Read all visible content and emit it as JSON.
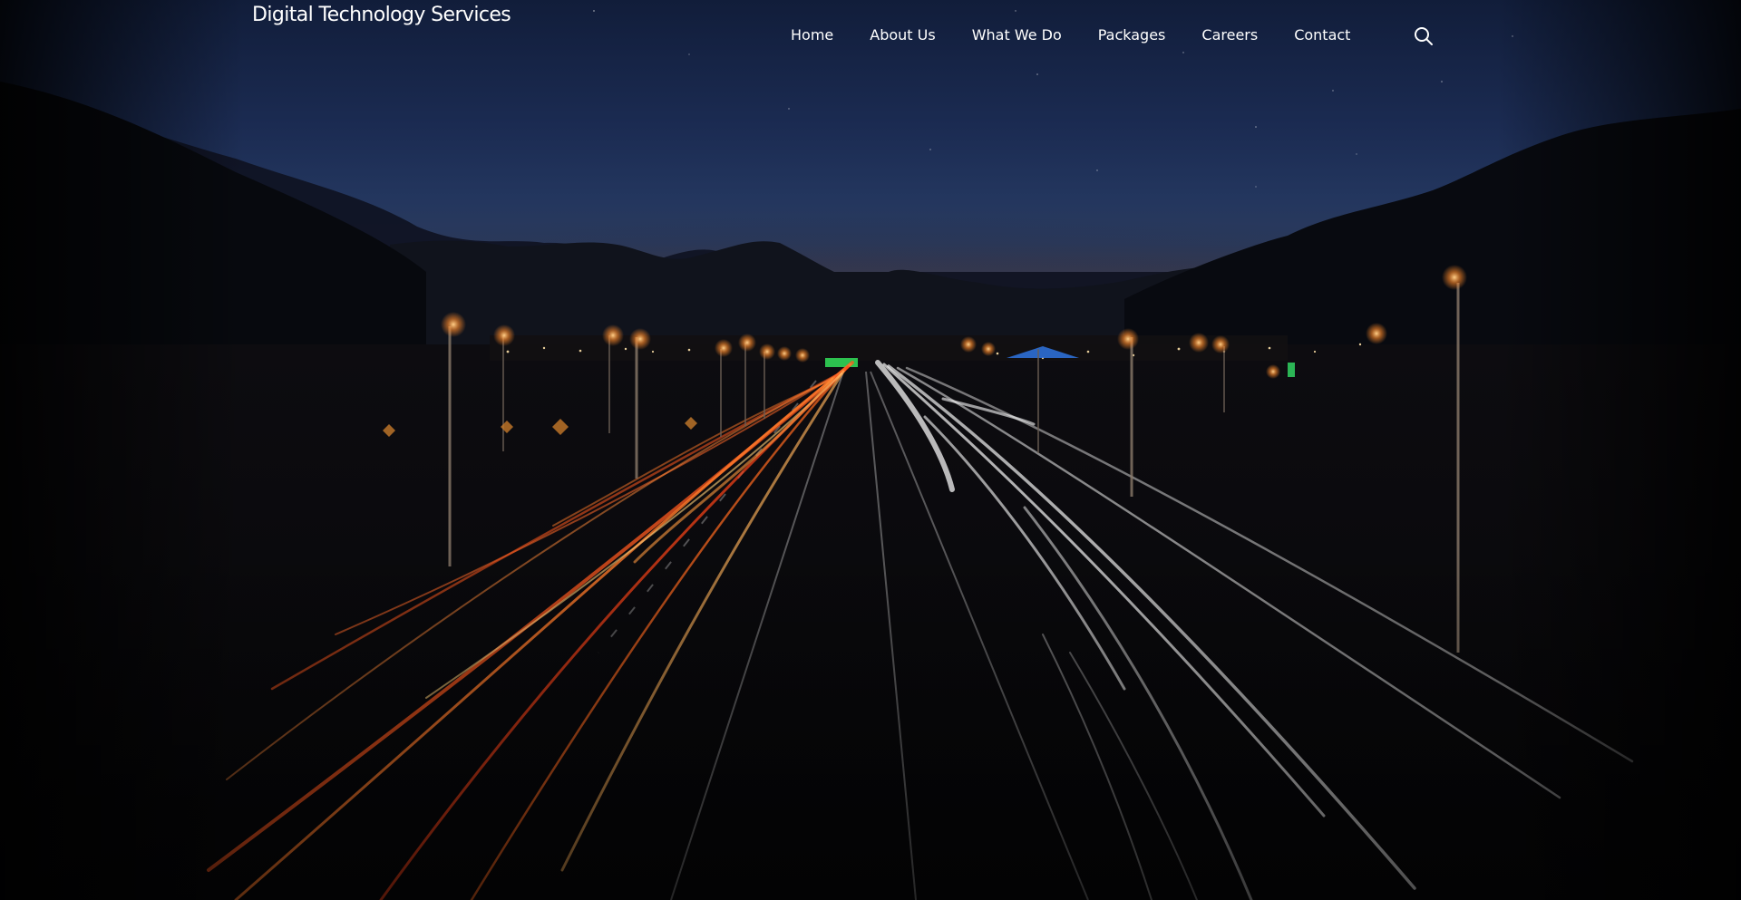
{
  "site": {
    "logo_text": "Digital Technology Services"
  },
  "nav": {
    "items": [
      {
        "label": "Home"
      },
      {
        "label": "About Us"
      },
      {
        "label": "What We Do"
      },
      {
        "label": "Packages"
      },
      {
        "label": "Careers"
      },
      {
        "label": "Contact"
      }
    ],
    "search_icon": "search-icon"
  },
  "hero": {
    "background": "night highway long-exposure photo with light trails",
    "colors": {
      "sky_top": "#111d3a",
      "sky_horizon": "#3a3b4e",
      "trail_red": "#ff5a1f",
      "trail_white": "#f2f2f2",
      "lamp": "#ffb15a"
    }
  }
}
